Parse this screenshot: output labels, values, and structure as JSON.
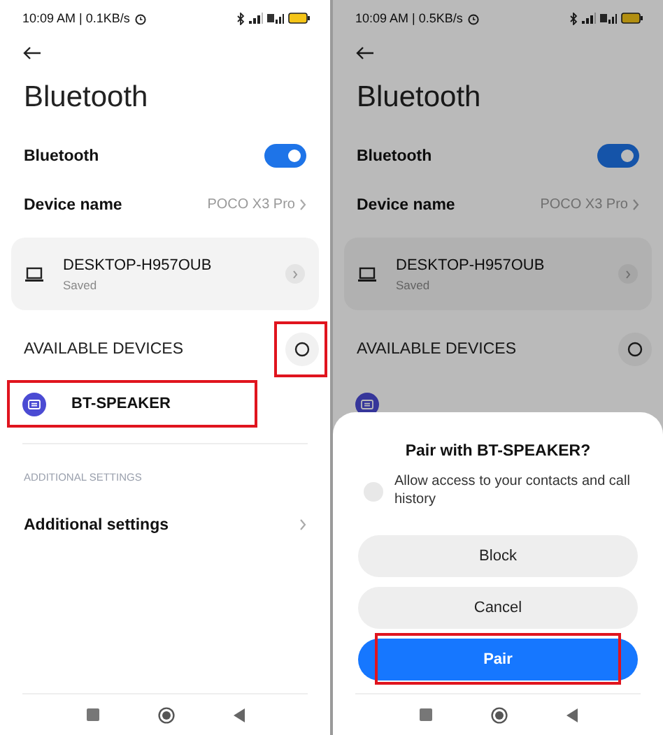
{
  "screens": [
    {
      "status": {
        "time": "10:09 AM | 0.1KB/s"
      },
      "title": "Bluetooth",
      "bluetooth": {
        "label": "Bluetooth",
        "on": true
      },
      "device_name": {
        "label": "Device name",
        "value": "POCO X3 Pro"
      },
      "paired_devices": [
        {
          "name": "DESKTOP-H957OUB",
          "status": "Saved"
        }
      ],
      "available": {
        "heading": "AVAILABLE DEVICES",
        "refresh_highlighted": true,
        "devices": [
          {
            "name": "BT-SPEAKER",
            "highlighted": true
          }
        ]
      },
      "additional": {
        "heading": "ADDITIONAL SETTINGS",
        "label": "Additional settings"
      }
    },
    {
      "status": {
        "time": "10:09 AM | 0.5KB/s"
      },
      "title": "Bluetooth",
      "bluetooth": {
        "label": "Bluetooth",
        "on": true
      },
      "device_name": {
        "label": "Device name",
        "value": "POCO X3 Pro"
      },
      "paired_devices": [
        {
          "name": "DESKTOP-H957OUB",
          "status": "Saved"
        }
      ],
      "available": {
        "heading": "AVAILABLE DEVICES",
        "refresh_highlighted": false,
        "devices": [
          {
            "highlighted": false
          }
        ]
      },
      "dialog": {
        "title": "Pair with BT-SPEAKER?",
        "option": {
          "label": "Allow access to your contacts and call history",
          "checked": false
        },
        "buttons": [
          {
            "label": "Block",
            "kind": "plain",
            "highlighted": false
          },
          {
            "label": "Cancel",
            "kind": "plain",
            "highlighted": false
          },
          {
            "label": "Pair",
            "kind": "primary",
            "highlighted": true
          }
        ]
      }
    }
  ]
}
